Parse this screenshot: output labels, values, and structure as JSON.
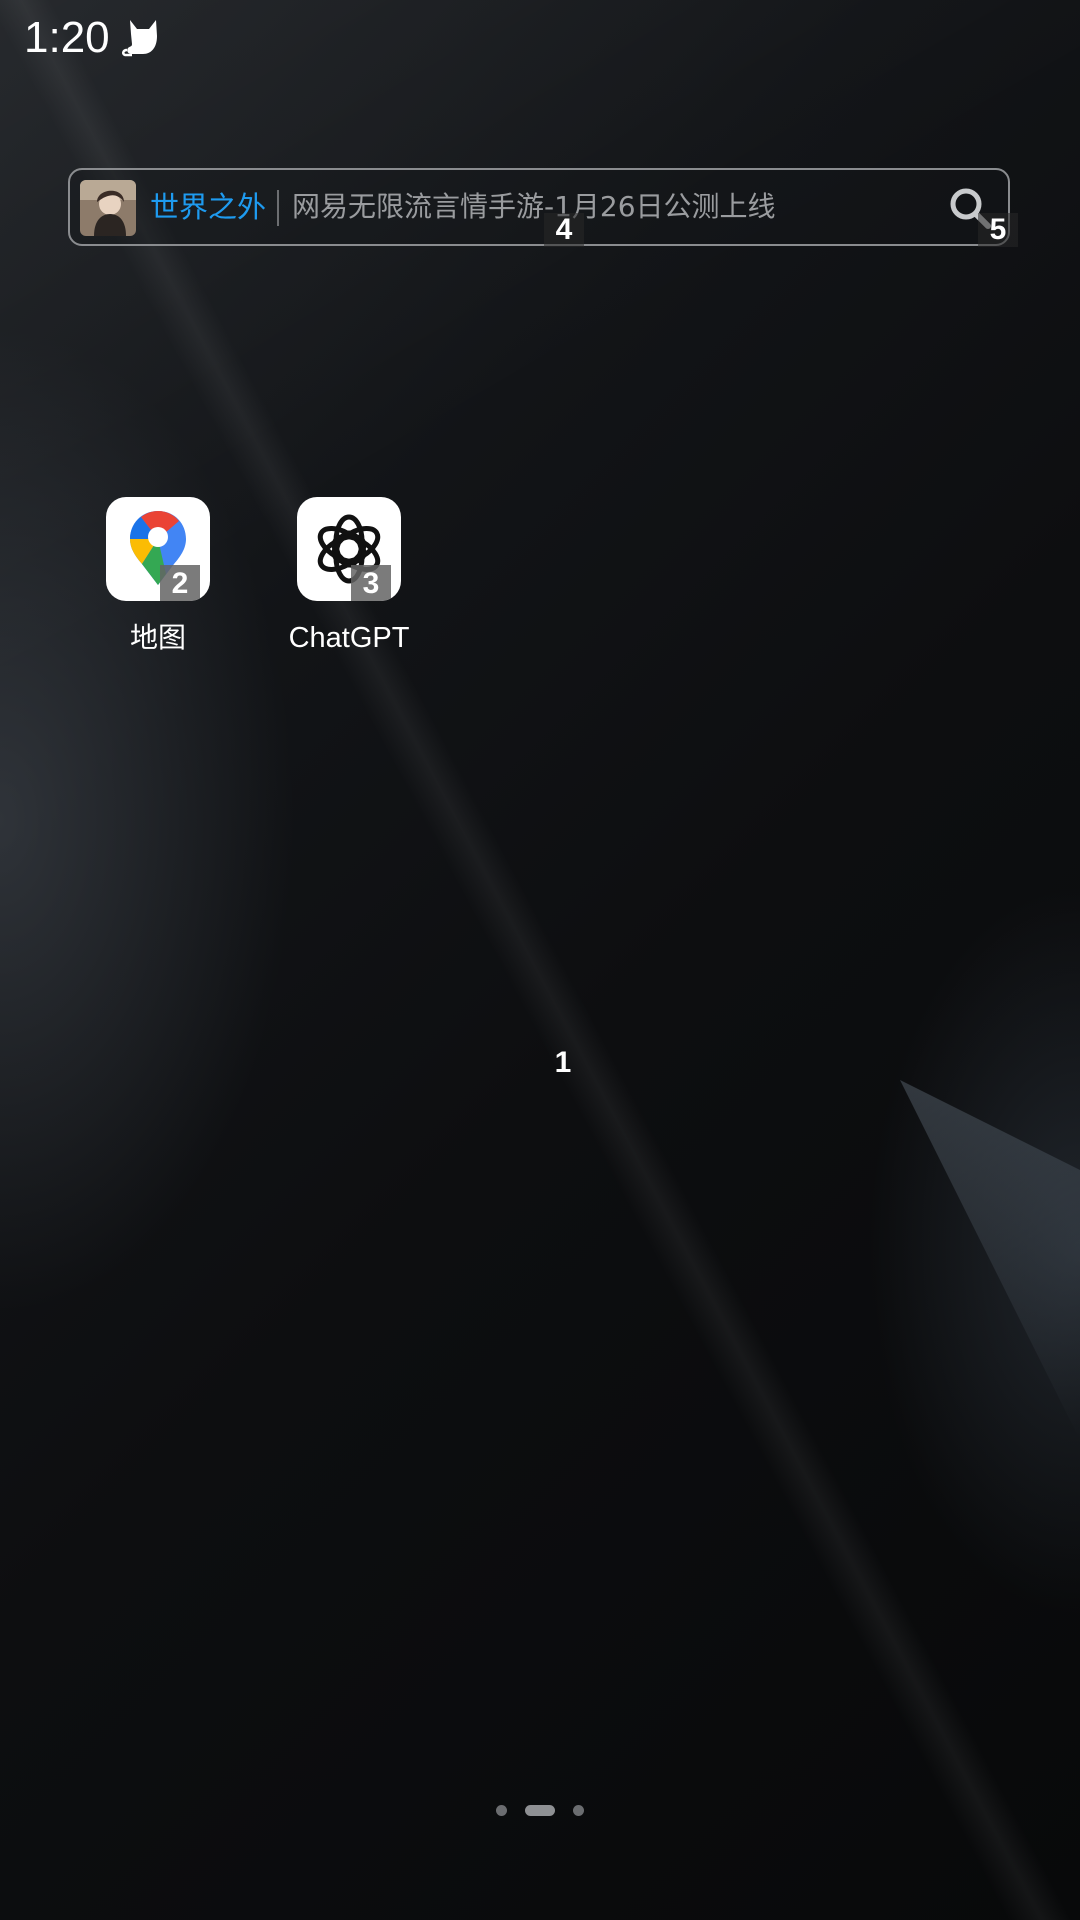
{
  "status_bar": {
    "time": "1:20",
    "notification_icon": "cat-icon"
  },
  "search_widget": {
    "keyword": "世界之外",
    "hint": "网易无限流言情手游-1月26日公测上线",
    "thumbnail_icon": "character-thumbnail",
    "search_icon": "search-icon"
  },
  "apps": [
    {
      "label": "地图",
      "icon": "google-maps-pin-icon",
      "marker": "2"
    },
    {
      "label": "ChatGPT",
      "icon": "openai-logo-icon",
      "marker": "3"
    }
  ],
  "markers": {
    "wallpaper": "1",
    "search_text": "4",
    "search_button": "5"
  },
  "page_indicator": {
    "total_pages": 3,
    "current_page": 2
  },
  "colors": {
    "keyword": "#1e9bf0",
    "hint": "#9a9c9f",
    "background": "#0b0c0e"
  }
}
